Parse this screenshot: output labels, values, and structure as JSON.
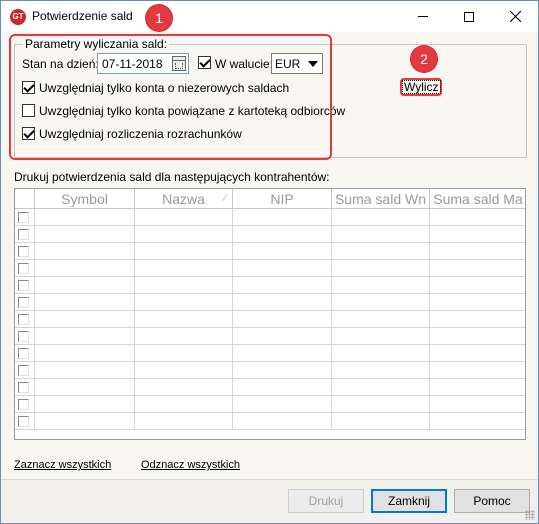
{
  "window": {
    "title": "Potwierdzenie sald",
    "app_icon": "app-logo-icon",
    "controls": [
      "minimize-icon",
      "maximize-icon",
      "close-icon"
    ]
  },
  "annotations": {
    "badge1": "1",
    "badge2": "2",
    "badge_color": "#e3393f"
  },
  "params": {
    "legend": "Parametry wyliczania sald:",
    "date_label": "Stan na dzień:",
    "date_value": "07-11-2018",
    "currency_checkbox_label": "W walucie:",
    "currency_checked": true,
    "currency_value": "EUR",
    "options": [
      {
        "label": "Uwzględniaj tylko konta o niezerowych saldach",
        "checked": true
      },
      {
        "label": "Uwzględniaj tylko konta powiązane z kartoteką odbiorców",
        "checked": false
      },
      {
        "label": "Uwzględniaj rozliczenia rozrachunków",
        "checked": true
      }
    ],
    "calculate_label": "Wylicz"
  },
  "list": {
    "caption": "Drukuj potwierdzenia sald dla następujących kontrahentów:",
    "columns": [
      "Symbol",
      "Nazwa",
      "NIP",
      "Suma sald Wn",
      "Suma sald Ma"
    ],
    "sort_indicator": "⁄",
    "row_count": 13
  },
  "links": {
    "select_all": "Zaznacz wszystkich",
    "deselect_all": "Odznacz wszystkich"
  },
  "buttons": {
    "print": "Drukuj",
    "close": "Zamknij",
    "help": "Pomoc"
  }
}
